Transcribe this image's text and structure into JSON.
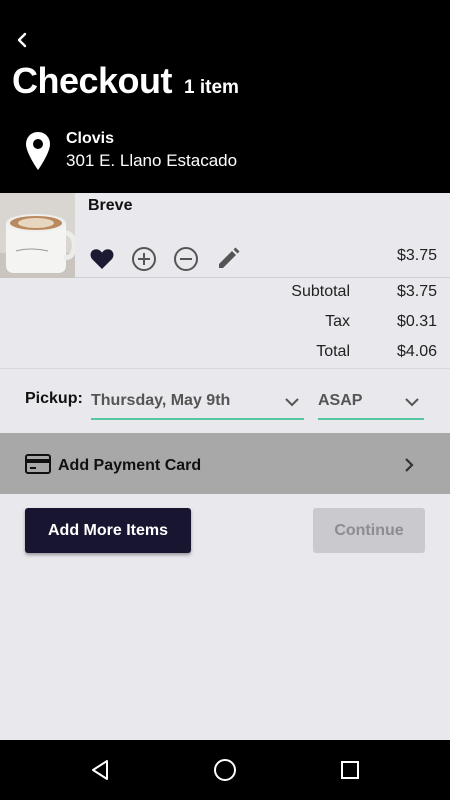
{
  "header": {
    "title": "Checkout",
    "item_count": "1 item",
    "location_name": "Clovis",
    "location_address": "301 E. Llano Estacado"
  },
  "cart": {
    "items": [
      {
        "name": "Breve",
        "price": "$3.75",
        "image": "coffee-mug-photo"
      }
    ]
  },
  "totals": {
    "subtotal_label": "Subtotal",
    "subtotal_value": "$3.75",
    "tax_label": "Tax",
    "tax_value": "$0.31",
    "total_label": "Total",
    "total_value": "$4.06"
  },
  "pickup": {
    "label": "Pickup:",
    "date_value": "Thursday, May 9th",
    "time_value": "ASAP"
  },
  "payment": {
    "label": "Add Payment Card"
  },
  "actions": {
    "add_more_label": "Add More Items",
    "continue_label": "Continue"
  },
  "colors": {
    "header_bg": "#000000",
    "primary_button": "#181530",
    "accent_underline": "#56c6a0",
    "disabled_button": "#cacace",
    "payment_row_bg": "#a8a8a8"
  },
  "icons": [
    "back-arrow-icon",
    "location-pin-icon",
    "heart-icon",
    "plus-circle-icon",
    "minus-circle-icon",
    "pencil-icon",
    "chevron-down-icon",
    "credit-card-icon",
    "chevron-right-icon",
    "nav-back-icon",
    "nav-home-icon",
    "nav-recents-icon"
  ]
}
